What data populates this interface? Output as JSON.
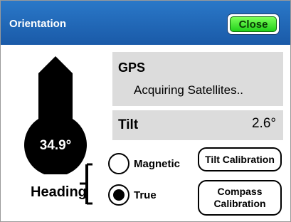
{
  "window": {
    "title": "Orientation",
    "close_label": "Close"
  },
  "gps": {
    "label": "GPS",
    "status": "Acquiring Satellites.."
  },
  "tilt": {
    "label": "Tilt",
    "value": "2.6°"
  },
  "compass": {
    "heading_value": "34.9°",
    "heading_label": "Heading"
  },
  "heading_mode": {
    "options": [
      "Magnetic",
      "True"
    ],
    "selected": "True"
  },
  "buttons": {
    "tilt_calibration": "Tilt Calibration",
    "compass_calibration_line1": "Compass",
    "compass_calibration_line2": "Calibration"
  },
  "colors": {
    "titlebar": "#1f66b8",
    "close_button": "#22d11a",
    "panel": "#dcdcdc"
  }
}
